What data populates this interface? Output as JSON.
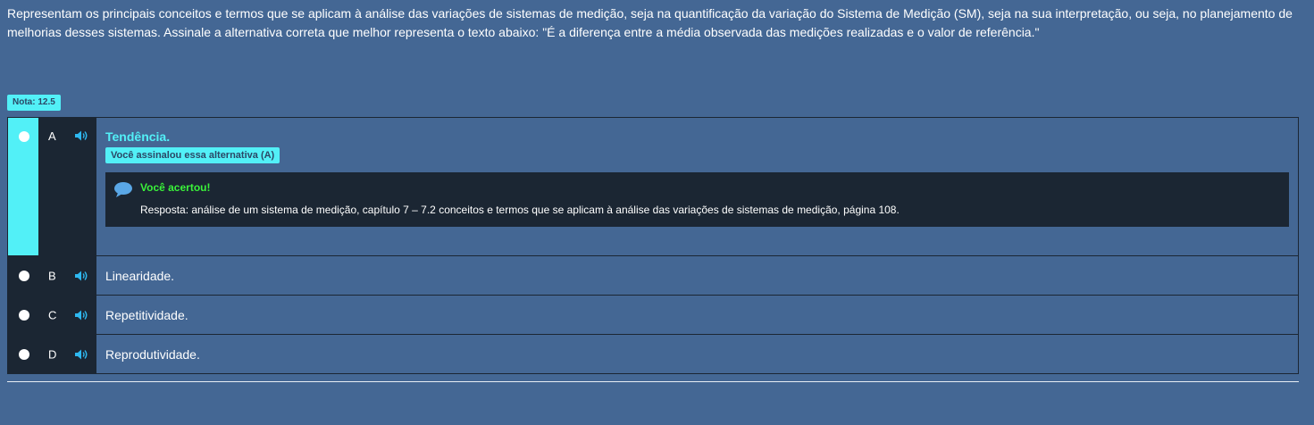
{
  "question": {
    "text": "Representam os principais conceitos e termos que se aplicam à análise das variações de sistemas de medição, seja na quantificação da variação do Sistema de Medição (SM), seja na sua interpretação, ou seja, no planejamento de melhorias desses sistemas. Assinale a alternativa correta que melhor representa o texto abaixo: \"É a diferença entre a média observada das medições realizadas e o valor de referência.\""
  },
  "score": {
    "label": "Nota: 12.5"
  },
  "options": [
    {
      "letter": "A",
      "text": "Tendência.",
      "selected": true,
      "icon": "speaker-icon"
    },
    {
      "letter": "B",
      "text": "Linearidade.",
      "selected": false,
      "icon": "speaker-icon"
    },
    {
      "letter": "C",
      "text": "Repetitividade.",
      "selected": false,
      "icon": "speaker-icon"
    },
    {
      "letter": "D",
      "text": "Reprodutividade.",
      "selected": false,
      "icon": "speaker-icon"
    }
  ],
  "selected_badge": "Você assinalou essa alternativa (A)",
  "feedback": {
    "icon": "chat-bubble-icon",
    "title": "Você acertou!",
    "text": "Resposta: análise de um sistema de medição, capítulo 7 – 7.2 conceitos e termos que se aplicam à análise das variações de sistemas de medição, página 108."
  },
  "colors": {
    "background": "#446794",
    "dark_panel": "#1b2633",
    "accent_cyan": "#52f0f7",
    "correct_green": "#3af23a"
  }
}
